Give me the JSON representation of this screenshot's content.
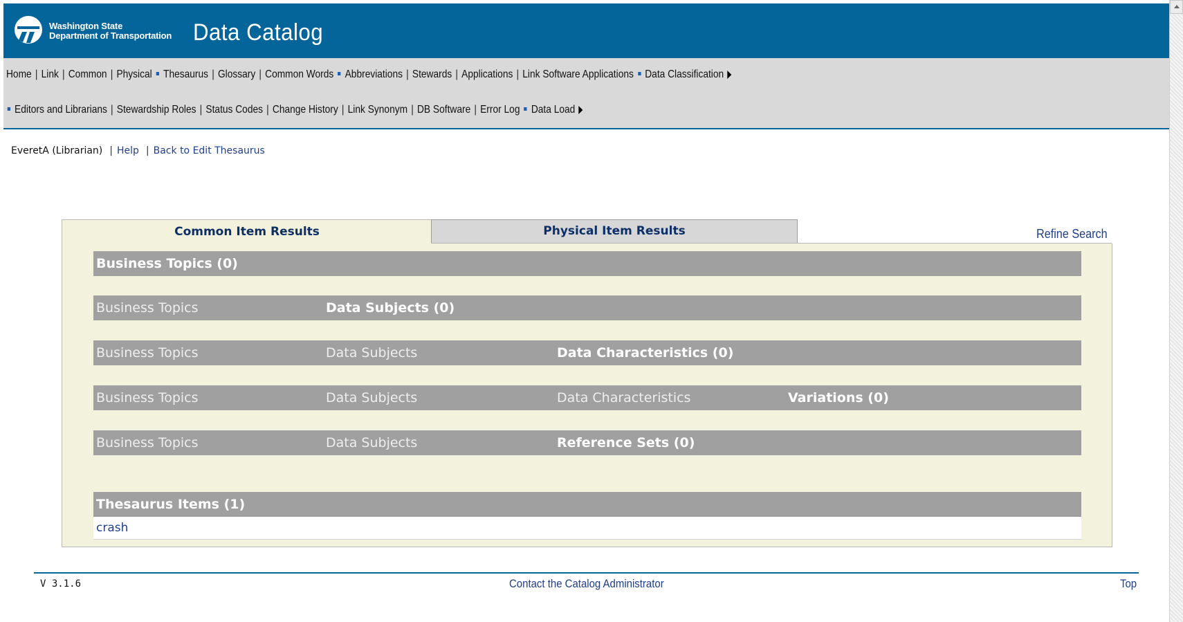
{
  "header": {
    "agency_line1": "Washington State",
    "agency_line2": "Department of Transportation",
    "app_title": "Data Catalog"
  },
  "nav": {
    "row1": [
      "Home",
      "Link",
      "Common",
      "Physical",
      "Thesaurus",
      "Glossary",
      "Common Words",
      "Abbreviations",
      "Stewards",
      "Applications",
      "Link Software Applications",
      "Data Classification"
    ],
    "row2": [
      "Editors and Librarians",
      "Stewardship Roles",
      "Status Codes",
      "Change History",
      "Link Synonym",
      "DB Software",
      "Error Log",
      "Data Load"
    ]
  },
  "userbar": {
    "user": "EveretA (Librarian)",
    "help": "Help",
    "back": "Back to Edit Thesaurus"
  },
  "tabs": {
    "common": "Common Item Results",
    "physical": "Physical Item Results",
    "refine": "Refine Search"
  },
  "results": {
    "business_topics": "Business Topics (0)",
    "data_subjects": "Data Subjects (0)",
    "data_characteristics": "Data Characteristics (0)",
    "variations": "Variations (0)",
    "reference_sets": "Reference Sets (0)",
    "thesaurus_items": "Thesaurus Items (1)",
    "crumb_business_topics": "Business Topics",
    "crumb_data_subjects": "Data Subjects",
    "crumb_data_characteristics": "Data Characteristics",
    "thesaurus_entry": "crash"
  },
  "footer": {
    "version": "V 3.1.6",
    "contact": "Contact the Catalog Administrator",
    "top": "Top"
  },
  "colors": {
    "brand_blue": "#03659a",
    "nav_gray": "#d9d9d9",
    "panel_bg": "#f3f2dc",
    "bar_gray": "#a0a0a0",
    "link_blue": "#1f3f8a"
  }
}
